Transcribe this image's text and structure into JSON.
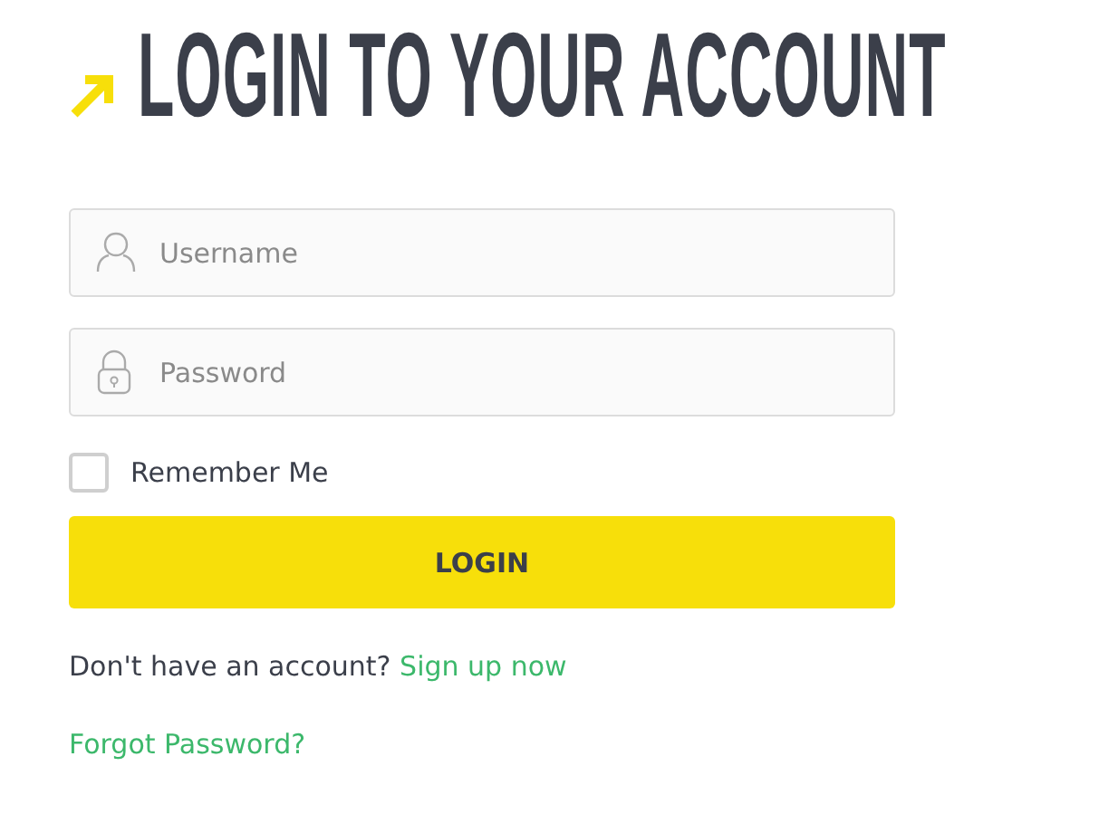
{
  "title": "LOGIN TO YOUR ACCOUNT",
  "fields": [
    {
      "kind": "user",
      "placeholder": "Username"
    },
    {
      "kind": "lock",
      "placeholder": "Password"
    }
  ],
  "remember": {
    "label": "Remember Me",
    "checked": false
  },
  "login_button": "LOGIN",
  "signup": {
    "text": "Don't have an account?",
    "link": "Sign up now"
  },
  "forgot_link": "Forgot Password?"
}
